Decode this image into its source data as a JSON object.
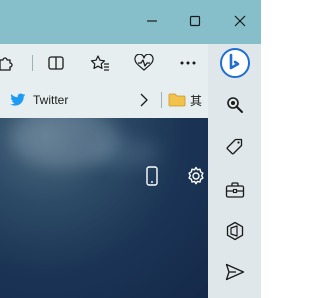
{
  "window_controls": {
    "minimize_icon": "minimize-icon",
    "maximize_icon": "maximize-icon",
    "close_icon": "close-icon"
  },
  "toolbar": {
    "icons": [
      "extensions-icon",
      "split-screen-icon",
      "favorites-icon",
      "browser-essentials-icon",
      "more-icon"
    ],
    "more_label": "···"
  },
  "favorites_bar": {
    "items": [
      {
        "label": "Twitter",
        "icon": "twitter-bird-icon"
      }
    ],
    "more_icon": "chevron-right-icon",
    "folder_label": "其",
    "folder_icon": "folder-icon"
  },
  "content": {
    "icons": [
      "phone-icon",
      "settings-gear-icon"
    ]
  },
  "sidebar": {
    "icons": [
      "copilot-icon",
      "search-icon",
      "shopping-tag-icon",
      "tools-briefcase-icon",
      "office-icon",
      "send-icon"
    ]
  },
  "colors": {
    "titlebar": "#86bfca",
    "toolbar": "#e6eef0",
    "sidebar": "#dfe7ea",
    "twitter_blue": "#1d9bf0",
    "folder_yellow": "#f2c14e",
    "copilot_blue": "#1f6fd1"
  }
}
